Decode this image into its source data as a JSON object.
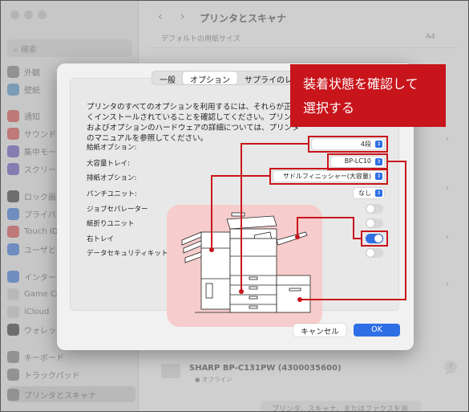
{
  "window": {
    "title": "プリンタとスキャナ",
    "back": "‹",
    "forward": "›"
  },
  "sidebar": {
    "search_placeholder": "検索",
    "items": [
      {
        "label": "外観",
        "color": "#9b9b9b"
      },
      {
        "label": "壁紙",
        "color": "#7ea7c9"
      },
      {
        "label": "通知",
        "color": "#d67a7a"
      },
      {
        "label": "サウンド",
        "color": "#d67a7a"
      },
      {
        "label": "集中モード",
        "color": "#8a7fc4"
      },
      {
        "label": "スクリーンタイム",
        "color": "#8a7fc4"
      },
      {
        "label": "ロック画面",
        "color": "#6b6b6b"
      },
      {
        "label": "プライバシー",
        "color": "#6d95d6"
      },
      {
        "label": "Touch ID",
        "color": "#d67a7a"
      },
      {
        "label": "ユーザとグループ",
        "color": "#6d95d6"
      },
      {
        "label": "インターネット",
        "color": "#6d95d6"
      },
      {
        "label": "Game Center",
        "color": "#cfcfcf"
      },
      {
        "label": "iCloud",
        "color": "#cfcfcf"
      },
      {
        "label": "ウォレット",
        "color": "#6b6b6b"
      },
      {
        "label": "キーボード",
        "color": "#9b9b9b"
      },
      {
        "label": "トラックパッド",
        "color": "#9b9b9b"
      },
      {
        "label": "プリンタとスキャナ",
        "color": "#9b9b9b"
      }
    ]
  },
  "main": {
    "default_paper_label": "デフォルトの用紙サイズ",
    "default_paper_value": "A4",
    "printer_name": "SHARP BP-C131PW (4300035600)",
    "printer_status": "● オフライン",
    "add_button": "プリンタ、スキャナ、またはファクスを追加..."
  },
  "sheet": {
    "tabs": [
      "一般",
      "オプション",
      "サプライのレ"
    ],
    "active_tab": 1,
    "description": "プリンタのすべてのオプションを利用するには、それらが正しくインストールされていることを確認してください。プリンタおよびオプションのハードウェアの詳細については、プリンタのマニュアルを参照してください。",
    "options": [
      {
        "label": "給紙オプション:",
        "type": "popup",
        "value": "4段"
      },
      {
        "label": "大容量トレイ:",
        "type": "popup",
        "value": "BP-LC10"
      },
      {
        "label": "排紙オプション:",
        "type": "popup",
        "value": "サドルフィニッシャー(大容量)"
      },
      {
        "label": "パンチユニット:",
        "type": "popup",
        "value": "なし"
      },
      {
        "label": "ジョブセパレーター",
        "type": "toggle",
        "on": false
      },
      {
        "label": "紙折りユニット",
        "type": "toggle",
        "on": false
      },
      {
        "label": "右トレイ",
        "type": "toggle",
        "on": true
      },
      {
        "label": "データセキュリティキット",
        "type": "toggle",
        "on": false
      }
    ],
    "cancel_label": "キャンセル",
    "ok_label": "OK"
  },
  "callout": {
    "line1": "装着状態を確認して",
    "line2": "選択する",
    "color": "#c8141b"
  }
}
